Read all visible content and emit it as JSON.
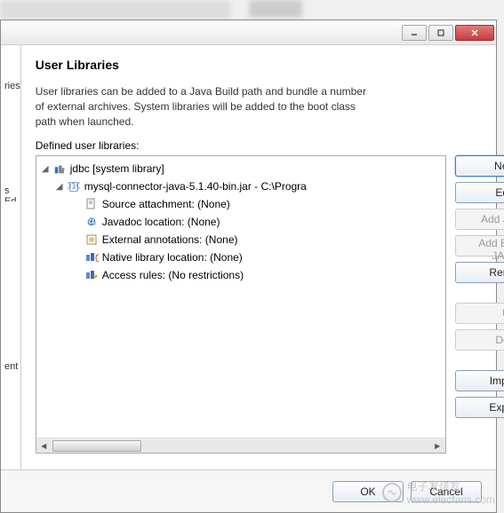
{
  "heading": "User Libraries",
  "description": "User libraries can be added to a Java Build path and bundle a number of external archives. System libraries will be added to the boot class path when launched.",
  "defined_label": "Defined user libraries:",
  "left_strip": {
    "item1": "ries",
    "item2": "s Ed",
    "item3": "ent"
  },
  "tree": {
    "root": {
      "label": "jdbc [system library]",
      "children": [
        {
          "label": "mysql-connector-java-5.1.40-bin.jar - C:\\Progra",
          "children": [
            {
              "label": "Source attachment: (None)"
            },
            {
              "label": "Javadoc location: (None)"
            },
            {
              "label": "External annotations: (None)"
            },
            {
              "label": "Native library location: (None)"
            },
            {
              "label": "Access rules: (No restrictions)"
            }
          ]
        }
      ]
    }
  },
  "buttons": {
    "new": "New...",
    "edit": "Edit...",
    "add_jars": "Add JARs...",
    "add_ext_jars": "Add External JARs...",
    "remove": "Remove",
    "up": "Up",
    "down": "Down",
    "import": "Import...",
    "export": "Export..."
  },
  "bottom": {
    "ok": "OK",
    "cancel": "Cancel"
  },
  "watermark": {
    "text": "www.elecfans.com",
    "brand": "电子发烧友"
  }
}
